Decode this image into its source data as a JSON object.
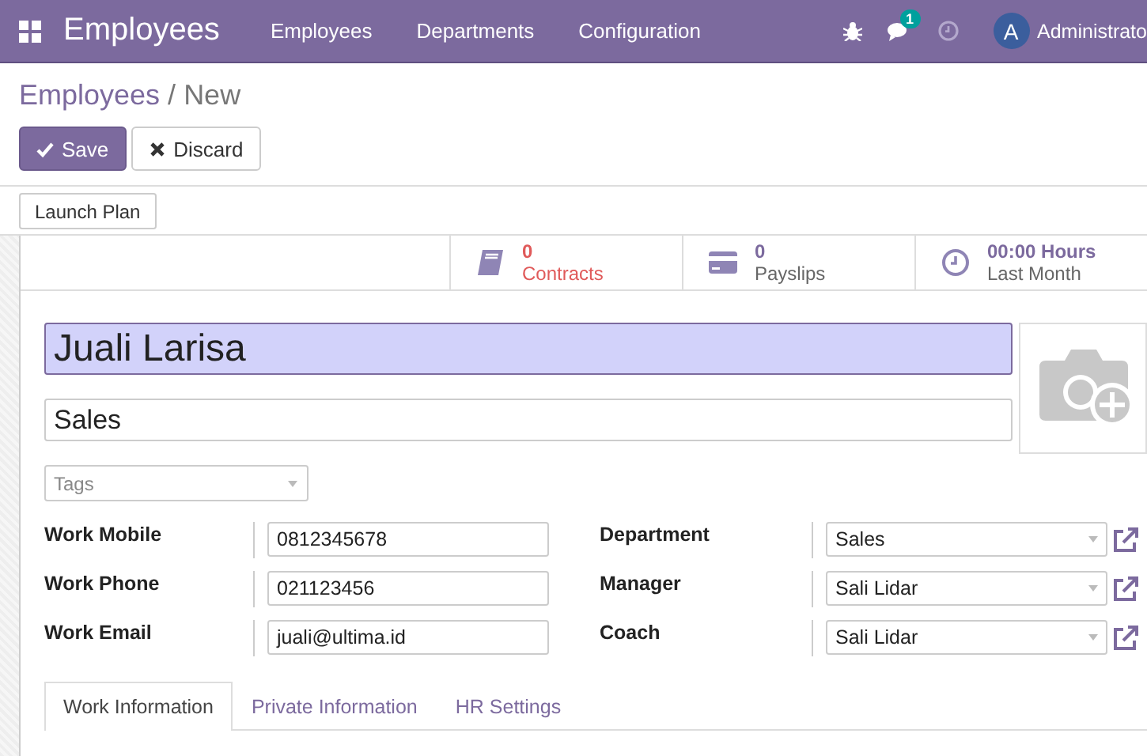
{
  "navbar": {
    "app_name": "Employees",
    "menu": [
      "Employees",
      "Departments",
      "Configuration"
    ],
    "messages_count": "1",
    "user_initial": "A",
    "user_name": "Administrato"
  },
  "breadcrumb": {
    "parent": "Employees",
    "separator": "/",
    "current": "New"
  },
  "buttons": [
    {
      "label": "Save",
      "kind": "primary"
    },
    {
      "label": "Discard",
      "kind": "secondary"
    }
  ],
  "header_buttons": [
    "Launch Plan"
  ],
  "stat_buttons": [
    {
      "kind": "book",
      "value": "0",
      "label": "Contracts",
      "alert": true
    },
    {
      "kind": "card",
      "value": "0",
      "label": "Payslips",
      "alert": false
    },
    {
      "kind": "clock",
      "value": "00:00 Hours",
      "label": "Last Month",
      "alert": false
    }
  ],
  "employee": {
    "name": "Juali Larisa",
    "job_title": "Sales",
    "tags_placeholder": "Tags"
  },
  "left_fields": [
    {
      "label": "Work Mobile",
      "value": "0812345678"
    },
    {
      "label": "Work Phone",
      "value": "021123456"
    },
    {
      "label": "Work Email",
      "value": "juali@ultima.id"
    }
  ],
  "right_fields": [
    {
      "label": "Department",
      "value": "Sales"
    },
    {
      "label": "Manager",
      "value": "Sali Lidar"
    },
    {
      "label": "Coach",
      "value": "Sali Lidar"
    }
  ],
  "tabs": [
    {
      "label": "Work Information",
      "selected": true
    },
    {
      "label": "Private Information",
      "selected": false
    },
    {
      "label": "HR Settings",
      "selected": false
    }
  ]
}
